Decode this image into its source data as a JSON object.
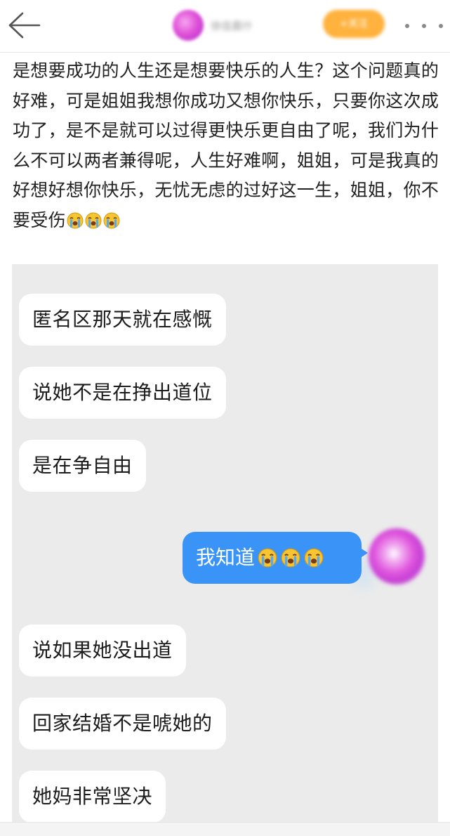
{
  "header": {
    "back_icon": "arrow-left-icon",
    "username": "徐佳晨什",
    "follow_label": "+关注",
    "more_icon": "more-dots-icon"
  },
  "post": {
    "text": "是想要成功的人生还是想要快乐的人生？这个问题真的好难，可是姐姐我想你成功又想你快乐，只要你这次成功了，是不是就可以过得更快乐更自由了呢，我们为什么不可以两者兼得呢，人生好难啊，姐姐，可是我真的好想好想你快乐，无忧无虑的过好这一生，姐姐，你不要受伤",
    "emoji": "loudly-crying-face-icon",
    "emoji_count": 3
  },
  "chat": {
    "messages": [
      {
        "side": "left",
        "text": "匿名区那天就在感慨"
      },
      {
        "side": "left",
        "text": "说她不是在挣出道位"
      },
      {
        "side": "left",
        "text": "是在争自由"
      },
      {
        "side": "right",
        "text": "我知道",
        "emoji": "loudly-crying-face-icon",
        "emoji_count": 3
      },
      {
        "side": "left",
        "text": "说如果她没出道"
      },
      {
        "side": "left",
        "text": "回家结婚不是唬她的"
      },
      {
        "side": "left",
        "text": "她妈非常坚决"
      }
    ]
  },
  "colors": {
    "sent_bubble": "#3a94f7",
    "chat_background": "#ebebeb",
    "follow_button": "#ffb23e"
  }
}
